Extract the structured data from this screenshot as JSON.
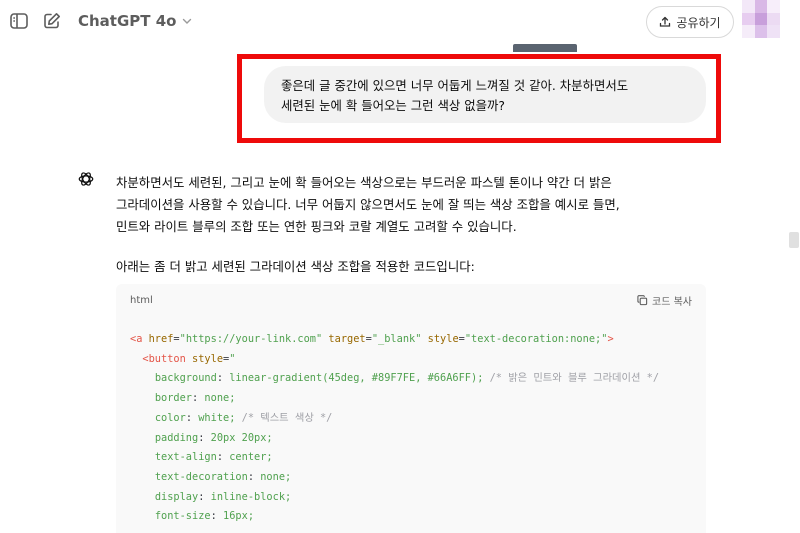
{
  "header": {
    "model_name": "ChatGPT 4o",
    "share_label": "공유하기"
  },
  "user_message": {
    "line1": "좋은데 글 중간에 있으면 너무 어둡게 느껴질 것 같아. 차분하면서도",
    "line2": "세련된 눈에 확 들어오는 그런 색상 없을까?"
  },
  "assistant": {
    "line1": "차분하면서도 세련된, 그리고 눈에 확 들어오는 색상으로는 부드러운 파스텔 톤이나 약간 더 밝은",
    "line2": "그라데이션을 사용할 수 있습니다. 너무 어둡지 않으면서도 눈에 잘 띄는 색상 조합을 예시로 들면,",
    "line3": "민트와 라이트 블루의 조합 또는 연한 핑크와 코랄 계열도 고려할 수 있습니다.",
    "intro": "아래는 좀 더 밝고 세련된 그라데이션 색상 조합을 적용한 코드입니다:"
  },
  "code": {
    "language": "html",
    "copy_label": "코드 복사",
    "a_open": "<a",
    "href_attr": "href",
    "href_val": "\"https://your-link.com\"",
    "target_attr": "target",
    "target_val": "\"_blank\"",
    "style_attr": "style",
    "a_style_val": "\"text-decoration:none;\"",
    "a_close": ">",
    "button_open": "<button",
    "button_style_open": "\"",
    "css_lines": [
      {
        "prop": "background",
        "value": "linear-gradient(45deg, #89F7FE, #66A6FF);",
        "comment": "/* 밝은 민트와 블루 그라데이션 */"
      },
      {
        "prop": "border",
        "value": "none;",
        "comment": ""
      },
      {
        "prop": "color",
        "value": "white;",
        "comment": "/* 텍스트 색상 */"
      },
      {
        "prop": "padding",
        "value": "20px 20px;",
        "comment": ""
      },
      {
        "prop": "text-align",
        "value": "center;",
        "comment": ""
      },
      {
        "prop": "text-decoration",
        "value": "none;",
        "comment": ""
      },
      {
        "prop": "display",
        "value": "inline-block;",
        "comment": ""
      },
      {
        "prop": "font-size",
        "value": "16px;",
        "comment": ""
      }
    ]
  },
  "colors": {
    "highlight": "#ee0a0a",
    "bubble_bg": "#f2f2f2",
    "code_bg": "#f9f9f9"
  },
  "avatar_colors": [
    "#f3e8f8",
    "#d9b8e6",
    "#f7eefa",
    "#e7cdf0",
    "#c89fdb",
    "#ecdbf3",
    "#f5ecf9",
    "#dcc0ea",
    "#efe2f6"
  ]
}
